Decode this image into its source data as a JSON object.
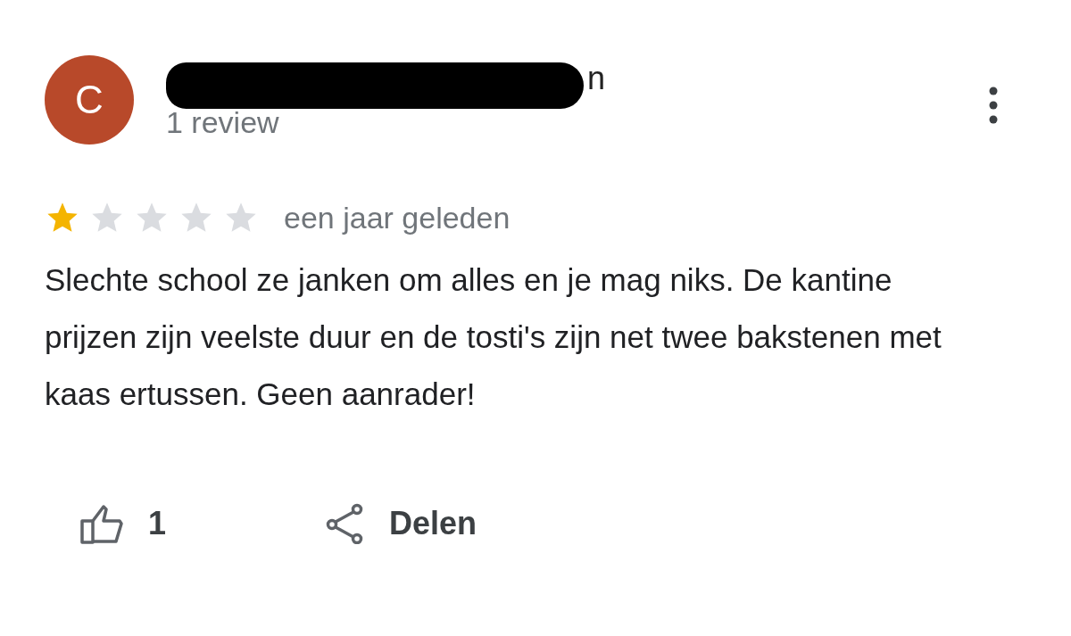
{
  "review": {
    "avatar_letter": "C",
    "name_visible_part": "n",
    "reviewer_info": "1 review",
    "stars": 1,
    "time": "een jaar geleden",
    "text": "Slechte school ze janken om alles en je mag niks. De kantine prijzen zijn veelste duur en de tosti's zijn net twee bakstenen met kaas ertussen. Geen aanrader!",
    "likes": "1",
    "share_label": "Delen"
  }
}
